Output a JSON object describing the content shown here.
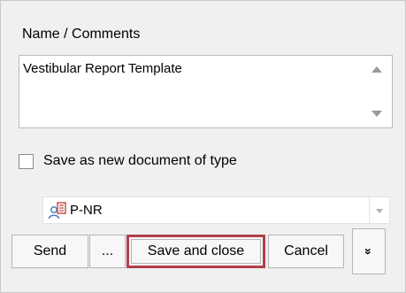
{
  "name_section": {
    "label": "Name / Comments",
    "value": "Vestibular Report Template"
  },
  "save_as_new": {
    "label": "Save as new document of type",
    "checked": false
  },
  "document_type": {
    "selected": "P-NR",
    "icon": "patient-report-icon"
  },
  "buttons": {
    "send": "Send",
    "more": "...",
    "save_and_close": "Save and close",
    "cancel": "Cancel",
    "expand": "»"
  },
  "highlight_color": "#b0414a"
}
